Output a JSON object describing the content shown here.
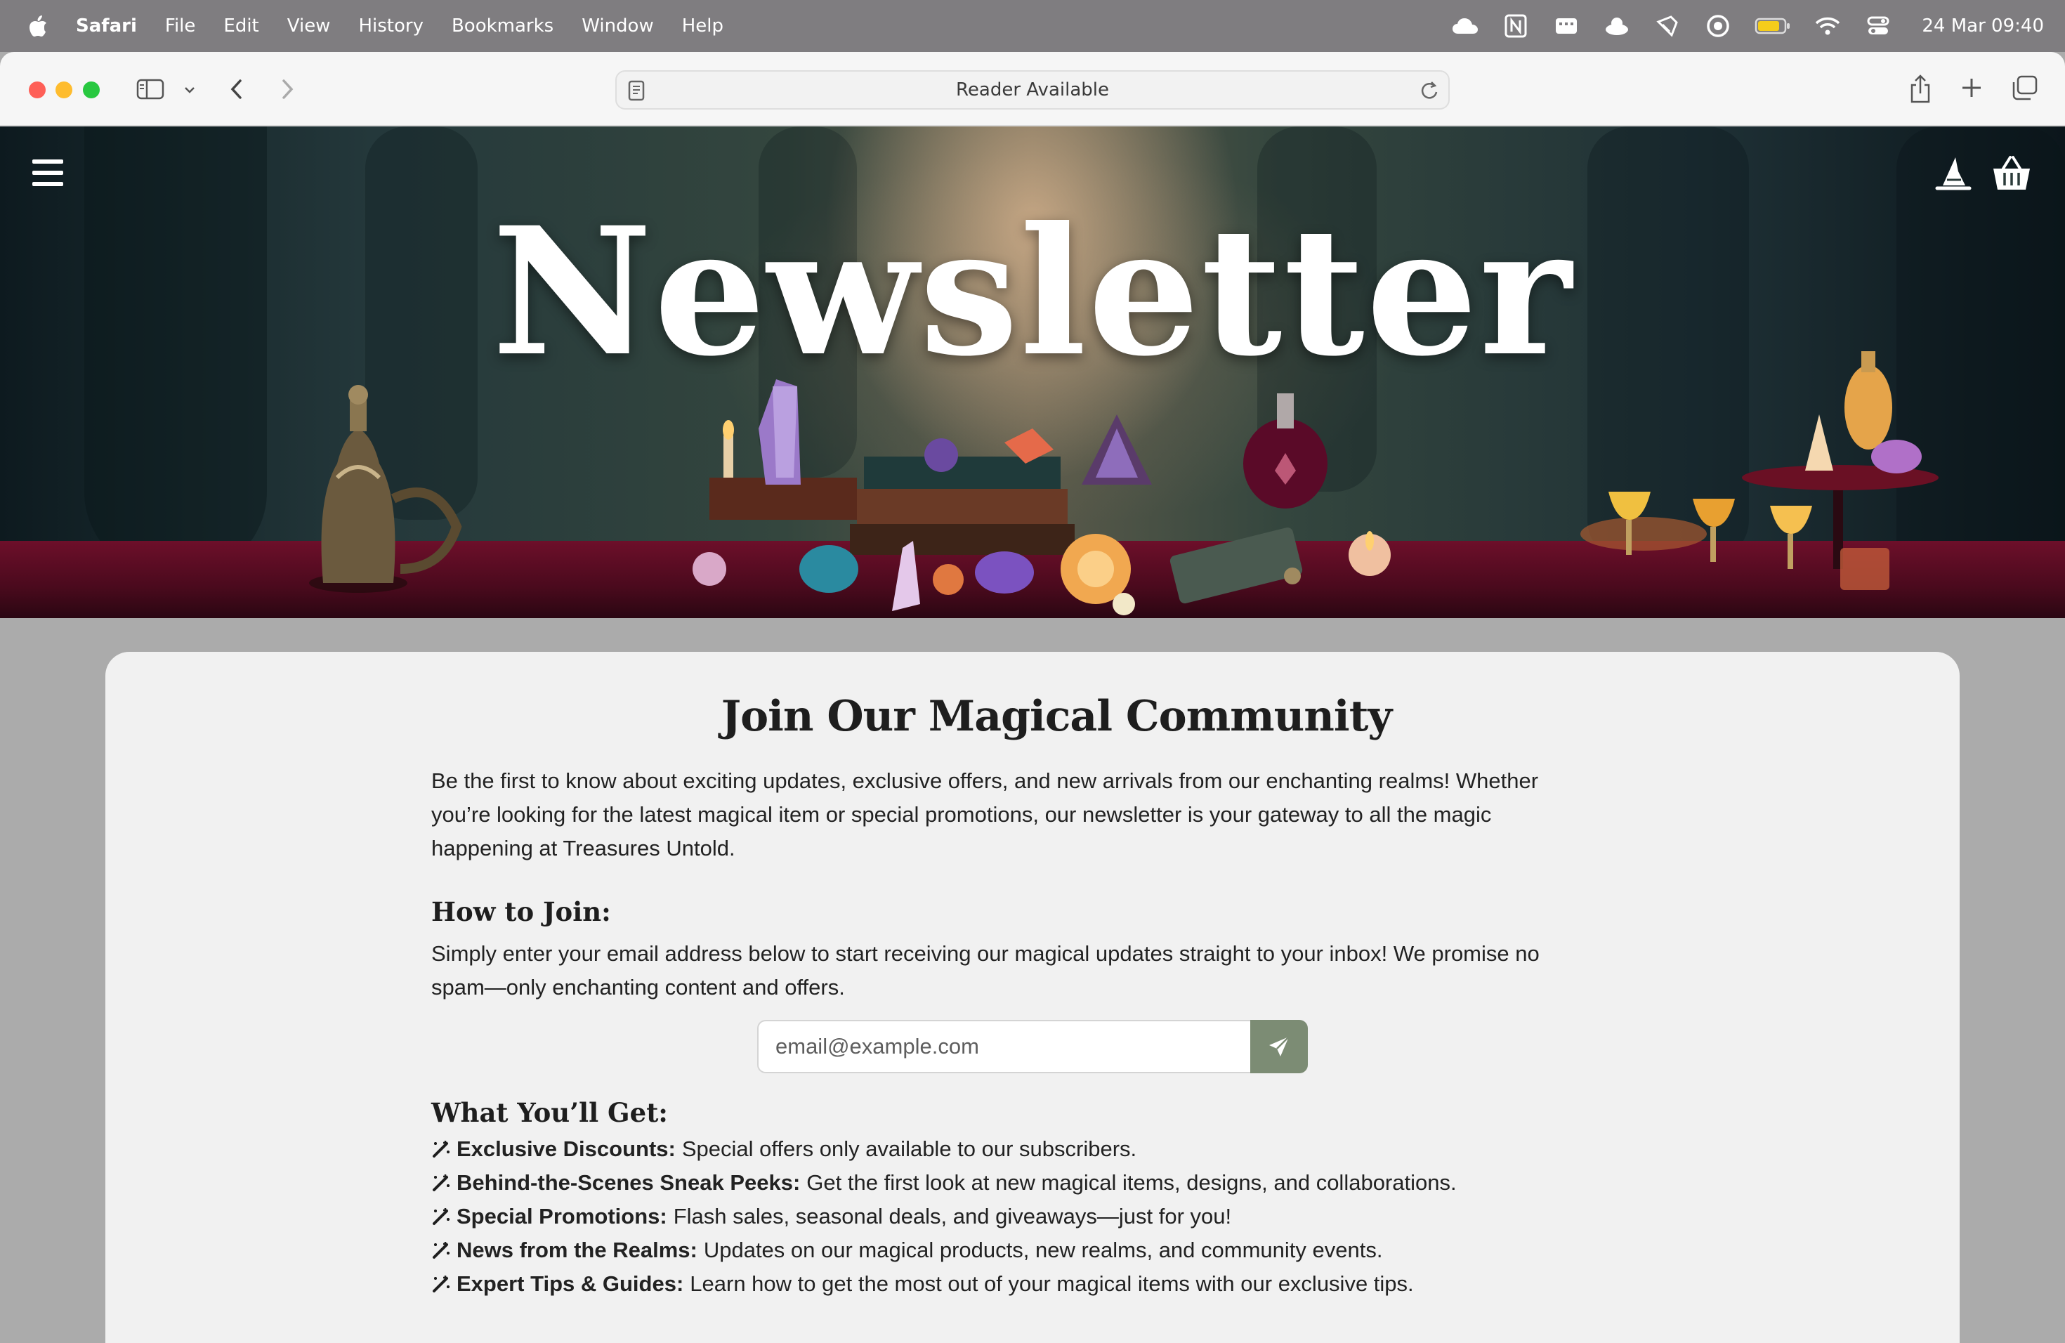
{
  "menubar": {
    "app": "Safari",
    "items": [
      "File",
      "Edit",
      "View",
      "History",
      "Bookmarks",
      "Window",
      "Help"
    ],
    "status_icons": [
      "creative-cloud-icon",
      "notion-icon",
      "screen-icon",
      "cloud-app-icon",
      "brush-icon",
      "record-icon",
      "battery-icon",
      "wifi-icon",
      "control-center-icon"
    ],
    "clock": "24 Mar  09:40"
  },
  "toolbar": {
    "address_text": "Reader Available"
  },
  "hero": {
    "title": "Newsletter"
  },
  "content": {
    "title": "Join Our Magical Community",
    "intro": "Be the first to know about exciting updates, exclusive offers, and new arrivals from our enchanting realms! Whether you’re looking for the latest magical item or special promotions, our newsletter is your gateway to all the magic happening at Treasures Untold.",
    "how_title": "How to Join:",
    "how_text": "Simply enter your email address below to start receiving our magical updates straight to your inbox! We promise no spam—only enchanting content and offers.",
    "email_placeholder": "email@example.com",
    "get_title": "What You’ll Get:",
    "benefits": [
      {
        "title": "Exclusive Discounts:",
        "text": "Special offers only available to our subscribers."
      },
      {
        "title": "Behind-the-Scenes Sneak Peeks:",
        "text": "Get the first look at new magical items, designs, and collaborations."
      },
      {
        "title": "Special Promotions:",
        "text": "Flash sales, seasonal deals, and giveaways—just for you!"
      },
      {
        "title": "News from the Realms:",
        "text": "Updates on our magical products, new realms, and community events."
      },
      {
        "title": "Expert Tips & Guides:",
        "text": "Learn how to get the most out of your magical items with our exclusive tips."
      }
    ]
  },
  "colors": {
    "send_button": "#7c8c74",
    "card_bg": "#f1f1f1",
    "page_bg": "#ababab"
  }
}
